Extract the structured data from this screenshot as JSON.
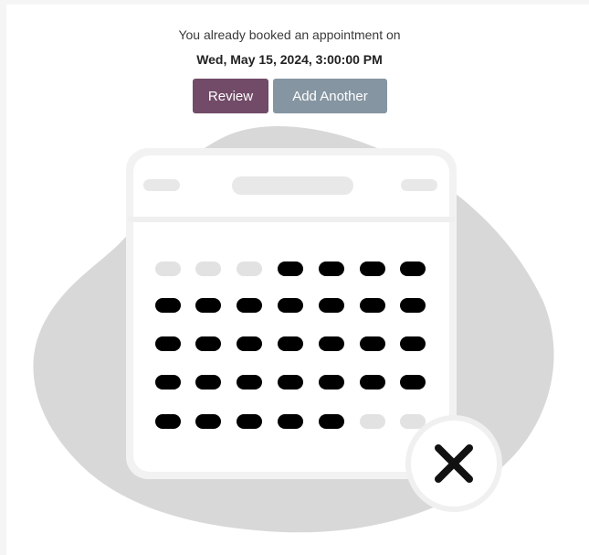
{
  "message": {
    "line1": "You already booked an appointment on",
    "datetime": "Wed, May 15, 2024, 3:00:00 PM"
  },
  "actions": {
    "review_label": "Review",
    "add_another_label": "Add Another"
  },
  "colors": {
    "review_button": "#714b67",
    "add_another_button": "#8595a2",
    "blob": "#d8d8d8",
    "calendar_dot_active": "#000000",
    "calendar_dot_inactive": "#e2e2e2"
  },
  "illustration": {
    "icon": "calendar-cancel-illustration",
    "badge_icon": "close-icon"
  }
}
